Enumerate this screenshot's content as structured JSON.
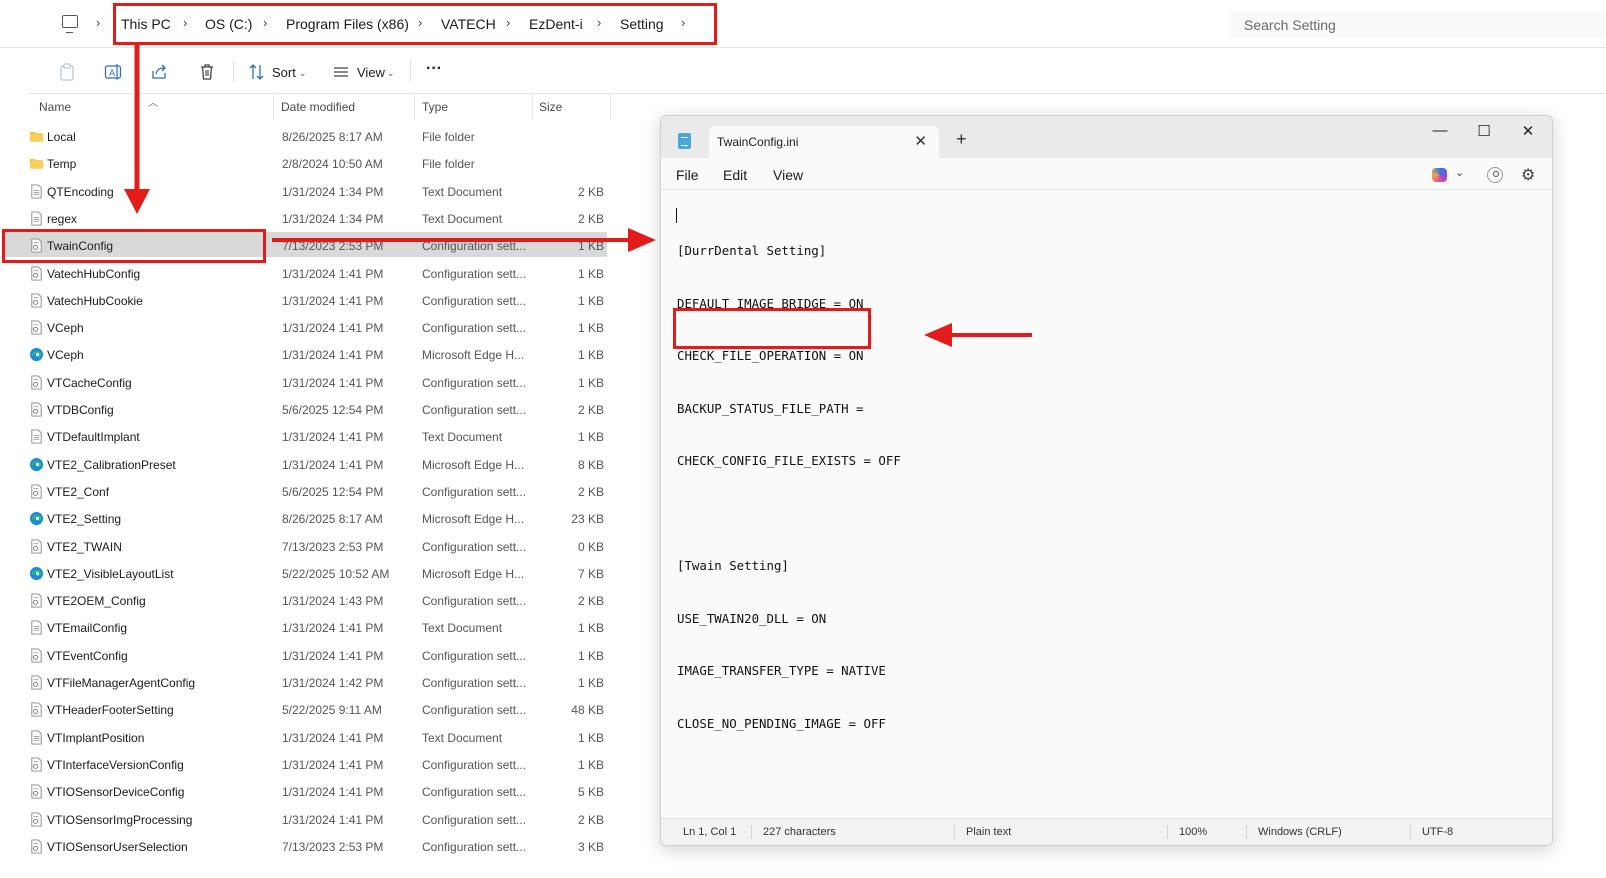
{
  "explorer": {
    "breadcrumb": [
      "This PC",
      "OS (C:)",
      "Program Files (x86)",
      "VATECH",
      "EzDent-i",
      "Setting"
    ],
    "search_placeholder": "Search Setting",
    "toolbar": {
      "sort_label": "Sort",
      "view_label": "View",
      "more_label": "···"
    },
    "columns": {
      "name": "Name",
      "date": "Date modified",
      "type": "Type",
      "size": "Size"
    },
    "files": [
      {
        "name": "Local",
        "date": "8/26/2025 8:17 AM",
        "type": "File folder",
        "size": "",
        "icon": "folder-icon"
      },
      {
        "name": "Temp",
        "date": "2/8/2024 10:50 AM",
        "type": "File folder",
        "size": "",
        "icon": "folder-icon"
      },
      {
        "name": "QTEncoding",
        "date": "1/31/2024 1:34 PM",
        "type": "Text Document",
        "size": "2 KB",
        "icon": "document-icon"
      },
      {
        "name": "regex",
        "date": "1/31/2024 1:34 PM",
        "type": "Text Document",
        "size": "2 KB",
        "icon": "document-icon"
      },
      {
        "name": "TwainConfig",
        "date": "7/13/2023 2:53 PM",
        "type": "Configuration sett...",
        "size": "1 KB",
        "icon": "config-file-icon",
        "selected": true
      },
      {
        "name": "VatechHubConfig",
        "date": "1/31/2024 1:41 PM",
        "type": "Configuration sett...",
        "size": "1 KB",
        "icon": "config-file-icon"
      },
      {
        "name": "VatechHubCookie",
        "date": "1/31/2024 1:41 PM",
        "type": "Configuration sett...",
        "size": "1 KB",
        "icon": "config-file-icon"
      },
      {
        "name": "VCeph",
        "date": "1/31/2024 1:41 PM",
        "type": "Configuration sett...",
        "size": "1 KB",
        "icon": "config-file-icon"
      },
      {
        "name": "VCeph",
        "date": "1/31/2024 1:41 PM",
        "type": "Microsoft Edge H...",
        "size": "1 KB",
        "icon": "edge-icon"
      },
      {
        "name": "VTCacheConfig",
        "date": "1/31/2024 1:41 PM",
        "type": "Configuration sett...",
        "size": "1 KB",
        "icon": "config-file-icon"
      },
      {
        "name": "VTDBConfig",
        "date": "5/6/2025 12:54 PM",
        "type": "Configuration sett...",
        "size": "2 KB",
        "icon": "config-file-icon"
      },
      {
        "name": "VTDefaultImplant",
        "date": "1/31/2024 1:41 PM",
        "type": "Text Document",
        "size": "1 KB",
        "icon": "document-icon"
      },
      {
        "name": "VTE2_CalibrationPreset",
        "date": "1/31/2024 1:41 PM",
        "type": "Microsoft Edge H...",
        "size": "8 KB",
        "icon": "edge-icon"
      },
      {
        "name": "VTE2_Conf",
        "date": "5/6/2025 12:54 PM",
        "type": "Configuration sett...",
        "size": "2 KB",
        "icon": "config-file-icon"
      },
      {
        "name": "VTE2_Setting",
        "date": "8/26/2025 8:17 AM",
        "type": "Microsoft Edge H...",
        "size": "23 KB",
        "icon": "edge-icon"
      },
      {
        "name": "VTE2_TWAIN",
        "date": "7/13/2023 2:53 PM",
        "type": "Configuration sett...",
        "size": "0 KB",
        "icon": "config-file-icon"
      },
      {
        "name": "VTE2_VisibleLayoutList",
        "date": "5/22/2025 10:52 AM",
        "type": "Microsoft Edge H...",
        "size": "7 KB",
        "icon": "edge-icon"
      },
      {
        "name": "VTE2OEM_Config",
        "date": "1/31/2024 1:43 PM",
        "type": "Configuration sett...",
        "size": "2 KB",
        "icon": "config-file-icon"
      },
      {
        "name": "VTEmailConfig",
        "date": "1/31/2024 1:41 PM",
        "type": "Text Document",
        "size": "1 KB",
        "icon": "document-icon"
      },
      {
        "name": "VTEventConfig",
        "date": "1/31/2024 1:41 PM",
        "type": "Configuration sett...",
        "size": "1 KB",
        "icon": "config-file-icon"
      },
      {
        "name": "VTFileManagerAgentConfig",
        "date": "1/31/2024 1:42 PM",
        "type": "Configuration sett...",
        "size": "1 KB",
        "icon": "config-file-icon"
      },
      {
        "name": "VTHeaderFooterSetting",
        "date": "5/22/2025 9:11 AM",
        "type": "Configuration sett...",
        "size": "48 KB",
        "icon": "config-file-icon"
      },
      {
        "name": "VTImplantPosition",
        "date": "1/31/2024 1:41 PM",
        "type": "Text Document",
        "size": "1 KB",
        "icon": "document-icon"
      },
      {
        "name": "VTInterfaceVersionConfig",
        "date": "1/31/2024 1:41 PM",
        "type": "Configuration sett...",
        "size": "1 KB",
        "icon": "config-file-icon"
      },
      {
        "name": "VTIOSensorDeviceConfig",
        "date": "1/31/2024 1:41 PM",
        "type": "Configuration sett...",
        "size": "5 KB",
        "icon": "config-file-icon"
      },
      {
        "name": "VTIOSensorImgProcessing",
        "date": "1/31/2024 1:41 PM",
        "type": "Configuration sett...",
        "size": "2 KB",
        "icon": "config-file-icon"
      },
      {
        "name": "VTIOSensorUserSelection",
        "date": "7/13/2023 2:53 PM",
        "type": "Configuration sett...",
        "size": "3 KB",
        "icon": "config-file-icon"
      }
    ]
  },
  "notepad": {
    "tab_title": "TwainConfig.ini",
    "menu": [
      "File",
      "Edit",
      "View"
    ],
    "lines": [
      "[DurrDental Setting]",
      "DEFAULT_IMAGE_BRIDGE = ON",
      "CHECK_FILE_OPERATION = ON",
      "BACKUP_STATUS_FILE_PATH =",
      "CHECK_CONFIG_FILE_EXISTS = OFF",
      "",
      "[Twain Setting]",
      "USE_TWAIN20_DLL = ON",
      "IMAGE_TRANSFER_TYPE = NATIVE",
      "CLOSE_NO_PENDING_IMAGE = OFF"
    ],
    "status": {
      "position": "Ln 1, Col 1",
      "chars": "227 characters",
      "format": "Plain text",
      "zoom": "100%",
      "line_ending": "Windows (CRLF)",
      "encoding": "UTF-8"
    }
  },
  "colors": {
    "annotation_red": "#e21b1b",
    "selection": "#d9d9d9",
    "folder": "#f4c042",
    "edge": "#1f8ad8"
  }
}
